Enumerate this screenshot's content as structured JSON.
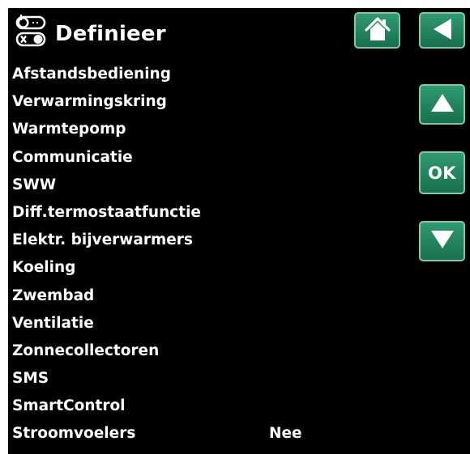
{
  "header": {
    "title": "Definieer",
    "title_icon": "switch-toggle-icon",
    "home_icon": "home-icon",
    "back_icon": "back-arrow-icon"
  },
  "nav": {
    "up_icon": "arrow-up-icon",
    "ok_label": "OK",
    "down_icon": "arrow-down-icon"
  },
  "colors": {
    "background": "#000000",
    "text": "#ffffff",
    "button_green": "#1f8a5e",
    "button_border": "#7fc8a8"
  },
  "menu": {
    "items": [
      {
        "label": "Afstandsbediening",
        "value": ""
      },
      {
        "label": "Verwarmingskring",
        "value": ""
      },
      {
        "label": "Warmtepomp",
        "value": ""
      },
      {
        "label": "Communicatie",
        "value": ""
      },
      {
        "label": "SWW",
        "value": ""
      },
      {
        "label": "Diff.termostaatfunctie",
        "value": ""
      },
      {
        "label": "Elektr. bijverwarmers",
        "value": ""
      },
      {
        "label": "Koeling",
        "value": ""
      },
      {
        "label": "Zwembad",
        "value": ""
      },
      {
        "label": "Ventilatie",
        "value": ""
      },
      {
        "label": "Zonnecollectoren",
        "value": ""
      },
      {
        "label": "SMS",
        "value": ""
      },
      {
        "label": "SmartControl",
        "value": ""
      },
      {
        "label": "Stroomvoelers",
        "value": "Nee"
      }
    ]
  }
}
